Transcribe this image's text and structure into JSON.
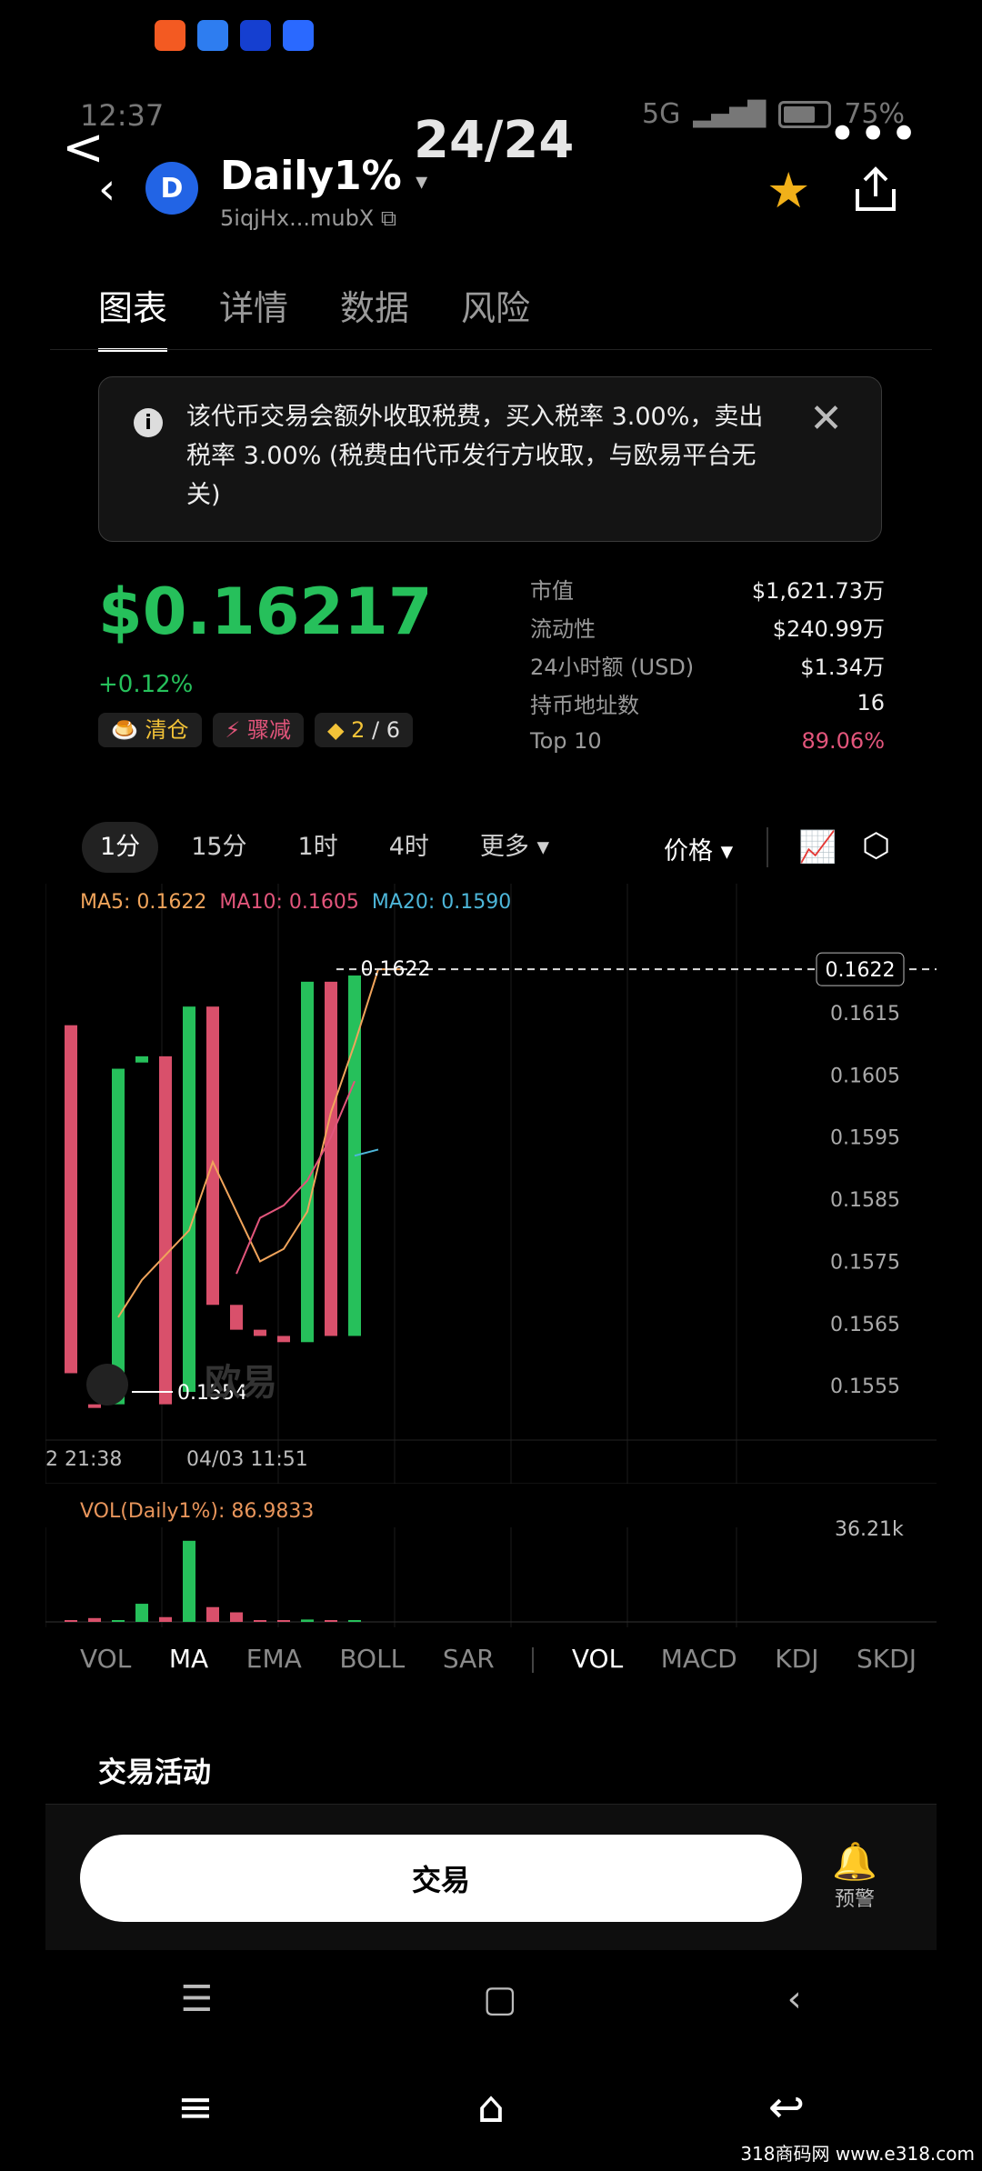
{
  "viewer": {
    "back": "<",
    "counter": "24/24",
    "more": "•••"
  },
  "status": {
    "time": "12:37",
    "network": "5G",
    "battery": "75%"
  },
  "header": {
    "back": "‹",
    "logo": "D",
    "name": "Daily1%",
    "dropdown": "▾",
    "address": "5iqjHx...mubX",
    "copy_icon": "⧉",
    "star_icon": "★"
  },
  "tabs": [
    "图表",
    "详情",
    "数据",
    "风险"
  ],
  "notice": {
    "icon": "i",
    "text": "该代币交易会额外收取税费，买入税率 3.00%，卖出税率 3.00% (税费由代币发行方收取，与欧易平台无关)",
    "close": "✕"
  },
  "price": {
    "value": "$0.16217",
    "change": "+0.12%"
  },
  "chips": {
    "chip1": "🍮 清仓",
    "chip2": "⚡ 骤减",
    "chip3_value": "◆ 2",
    "chip3_total": " / 6"
  },
  "stats": [
    {
      "k": "市值",
      "v": "$1,621.73万"
    },
    {
      "k": "流动性",
      "v": "$240.99万"
    },
    {
      "k": "24小时额 (USD)",
      "v": "$1.34万"
    },
    {
      "k": "持币地址数",
      "v": "16"
    },
    {
      "k": "Top 10",
      "v": "89.06%"
    }
  ],
  "timeframes": [
    "1分",
    "15分",
    "1时",
    "4时",
    "更多 ▾"
  ],
  "price_selector": "价格 ▾",
  "indicator_icon": "📈",
  "settings_icon": "⬡",
  "ma": {
    "ma5": "MA5: 0.1622",
    "ma10": "MA10: 0.1605",
    "ma20": "MA20: 0.1590"
  },
  "colors": {
    "up": "#26c05b",
    "down": "#d9506b",
    "ma5": "#f0a45b",
    "ma10": "#e2557b",
    "ma20": "#4db6d9"
  },
  "chart_data": {
    "type": "candlestick",
    "ylim": [
      0.1548,
      0.1627
    ],
    "yticks": [
      "0.1615",
      "0.1605",
      "0.1595",
      "0.1585",
      "0.1575",
      "0.1565",
      "0.1555"
    ],
    "last_price_label": "0.1622",
    "last_price": 0.1622,
    "low_label": "0.1554",
    "xticks": [
      "2 21:38",
      "04/03 11:51"
    ],
    "candles": [
      {
        "o": 0.1613,
        "c": 0.1557,
        "dir": "down"
      },
      {
        "o": 0.1552,
        "c": 0.1552,
        "dir": "down"
      },
      {
        "o": 0.1552,
        "c": 0.1606,
        "dir": "up"
      },
      {
        "o": 0.1607,
        "c": 0.1608,
        "dir": "up"
      },
      {
        "o": 0.1608,
        "c": 0.1552,
        "dir": "down"
      },
      {
        "o": 0.1554,
        "c": 0.1616,
        "dir": "up"
      },
      {
        "o": 0.1616,
        "c": 0.1568,
        "dir": "down"
      },
      {
        "o": 0.1568,
        "c": 0.1564,
        "dir": "down"
      },
      {
        "o": 0.1564,
        "c": 0.1563,
        "dir": "down"
      },
      {
        "o": 0.1563,
        "c": 0.1562,
        "dir": "down"
      },
      {
        "o": 0.1562,
        "c": 0.162,
        "dir": "up"
      },
      {
        "o": 0.162,
        "c": 0.1563,
        "dir": "down"
      },
      {
        "o": 0.1563,
        "c": 0.1621,
        "dir": "up"
      }
    ],
    "ma5": [
      0.1566,
      0.1572,
      0.1576,
      0.158,
      0.1591,
      0.1583,
      0.1575,
      0.1577,
      0.1583,
      0.1599,
      0.161,
      0.1622,
      0.1622
    ],
    "ma10": [
      0.1573,
      0.1582,
      0.1584,
      0.1588,
      0.1595,
      0.1604
    ],
    "ma20": [
      0.1592,
      0.1593
    ],
    "volume_max": 36210,
    "volumes": [
      0,
      1600,
      0,
      7600,
      2000,
      34000,
      6200,
      4000,
      0,
      0,
      1000,
      0,
      0
    ]
  },
  "watermark_text": "欧易",
  "vol": {
    "title": "VOL(Daily1%): 86.9833",
    "max": "36.21k"
  },
  "indicator_tabs": [
    "VOL",
    "MA",
    "EMA",
    "BOLL",
    "SAR",
    "VOL",
    "MACD",
    "KDJ",
    "SKDJ"
  ],
  "section_title": "交易活动",
  "trade_button": "交易",
  "alert_label": "预警",
  "alert_icon": "🔔",
  "site_watermark": "318商码网 www.e318.com"
}
